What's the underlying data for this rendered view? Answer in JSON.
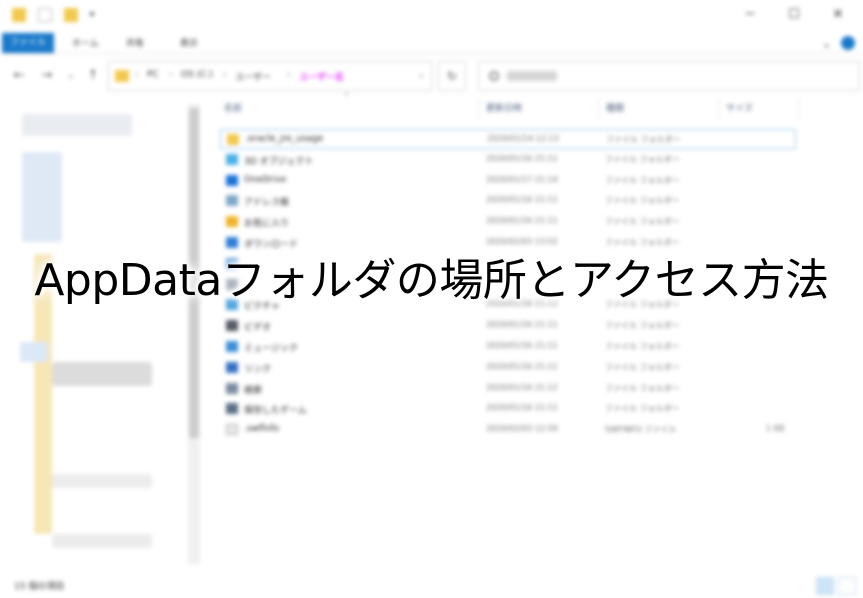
{
  "headline": "AppDataフォルダの場所とアクセス方法",
  "window": {
    "minimize": "─",
    "maximize": "☐",
    "close": "✕",
    "qa_dropdown": "▾"
  },
  "ribbon": {
    "tabs": [
      "ファイル",
      "ホーム",
      "共有",
      "表示"
    ],
    "chevron": "⌄"
  },
  "nav": {
    "back": "←",
    "forward": "→",
    "recent": "⌄",
    "up": "↑",
    "refresh": "↻"
  },
  "address": {
    "crumbs": [
      "PC",
      "OS (C:)",
      "ユーザー",
      "ユーザー名"
    ],
    "separator": "›",
    "dropdown": "⌄"
  },
  "columns": {
    "name": "名前",
    "date": "更新日時",
    "type": "種類",
    "size": "サイズ",
    "sort_arrow": "^"
  },
  "files": [
    {
      "name": ".oracle_jre_usage",
      "date": "2020/01/14 12:13",
      "type": "ファイル フォルダー",
      "size": "",
      "icon": "folder-icon",
      "color": "#f2c94c",
      "selected": true
    },
    {
      "name": "3D オブジェクト",
      "date": "2020/01/16 21:11",
      "type": "ファイル フォルダー",
      "size": "",
      "icon": "3d-objects-icon",
      "color": "#4ab0e8"
    },
    {
      "name": "OneDrive",
      "date": "2020/01/17 21:14",
      "type": "ファイル フォルダー",
      "size": "",
      "icon": "onedrive-icon",
      "color": "#1a73d9"
    },
    {
      "name": "アドレス帳",
      "date": "2020/01/16 21:11",
      "type": "ファイル フォルダー",
      "size": "",
      "icon": "contacts-icon",
      "color": "#7fa7c9"
    },
    {
      "name": "お気に入り",
      "date": "2020/01/16 21:11",
      "type": "ファイル フォルダー",
      "size": "",
      "icon": "favorites-star-icon",
      "color": "#f0b429"
    },
    {
      "name": "ダウンロード",
      "date": "2020/02/03 13:52",
      "type": "ファイル フォルダー",
      "size": "",
      "icon": "download-icon",
      "color": "#2d7fd6"
    },
    {
      "name": "",
      "date": "",
      "type": "",
      "size": "",
      "icon": "desktop-icon",
      "color": "#5aa0e0"
    },
    {
      "name": "",
      "date": "",
      "type": "",
      "size": "",
      "icon": "documents-icon",
      "color": "#9aa6b5"
    },
    {
      "name": "ピクチャ",
      "date": "2020/01/16 21:12",
      "type": "ファイル フォルダー",
      "size": "",
      "icon": "pictures-icon",
      "color": "#4aa3df"
    },
    {
      "name": "ビデオ",
      "date": "2020/01/16 21:11",
      "type": "ファイル フォルダー",
      "size": "",
      "icon": "videos-icon",
      "color": "#555c66"
    },
    {
      "name": "ミュージック",
      "date": "2020/01/16 21:11",
      "type": "ファイル フォルダー",
      "size": "",
      "icon": "music-icon",
      "color": "#3d8fd8"
    },
    {
      "name": "リンク",
      "date": "2020/01/16 21:11",
      "type": "ファイル フォルダー",
      "size": "",
      "icon": "links-icon",
      "color": "#3571c4"
    },
    {
      "name": "検索",
      "date": "2020/01/16 21:12",
      "type": "ファイル フォルダー",
      "size": "",
      "icon": "search-folder-icon",
      "color": "#7a8ba0"
    },
    {
      "name": "保存したゲーム",
      "date": "2020/01/16 21:11",
      "type": "ファイル フォルダー",
      "size": "",
      "icon": "saved-games-icon",
      "color": "#5b6f86"
    },
    {
      "name": ".swflnfo",
      "date": "2020/02/03 12:59",
      "type": "SWFINFO ファイル",
      "size": "1 KB",
      "icon": "file-icon",
      "color": "#e8e8e8"
    }
  ],
  "status": {
    "count": "15 個の項目"
  },
  "colors": {
    "accent": "#1979ca",
    "user_crumb": "#e040fb"
  }
}
